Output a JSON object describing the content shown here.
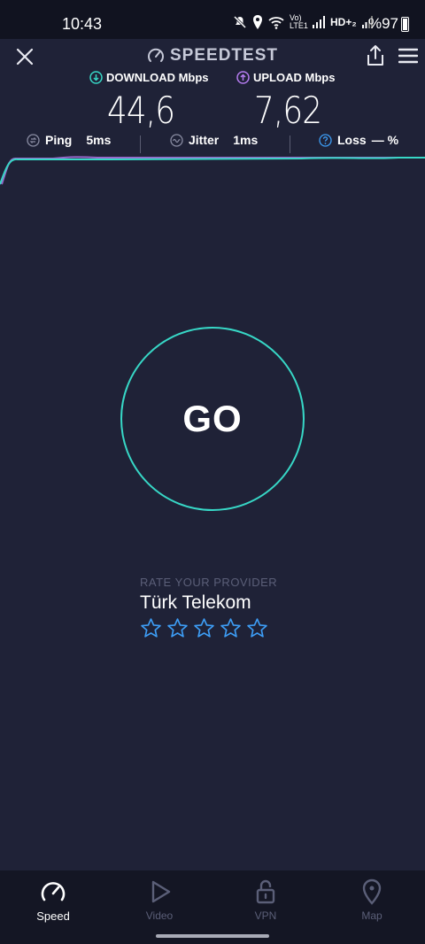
{
  "status_bar": {
    "time": "10:43",
    "network_text": "Vo) LTE1",
    "hd_text": "HD+₂",
    "battery_text": "%97"
  },
  "header": {
    "title": "SPEEDTEST"
  },
  "speeds": {
    "download_label": "DOWNLOAD Mbps",
    "download_value": "44,6",
    "upload_label": "UPLOAD Mbps",
    "upload_value": "7,62",
    "download_color": "#37d7c6",
    "upload_color": "#b57cf0"
  },
  "metrics": {
    "ping_label": "Ping",
    "ping_value": "5ms",
    "jitter_label": "Jitter",
    "jitter_value": "1ms",
    "loss_label": "Loss",
    "loss_value": "— %"
  },
  "go_button": {
    "label": "GO",
    "ring_color": "#37d7c6"
  },
  "rating": {
    "caption": "RATE YOUR PROVIDER",
    "provider": "Türk Telekom",
    "star_count": 5,
    "star_color": "#3d9df5"
  },
  "bottom_nav": {
    "items": [
      {
        "label": "Speed",
        "icon": "speedometer-icon",
        "active": true
      },
      {
        "label": "Video",
        "icon": "play-icon",
        "active": false
      },
      {
        "label": "VPN",
        "icon": "unlock-icon",
        "active": false
      },
      {
        "label": "Map",
        "icon": "map-pin-icon",
        "active": false
      }
    ]
  }
}
